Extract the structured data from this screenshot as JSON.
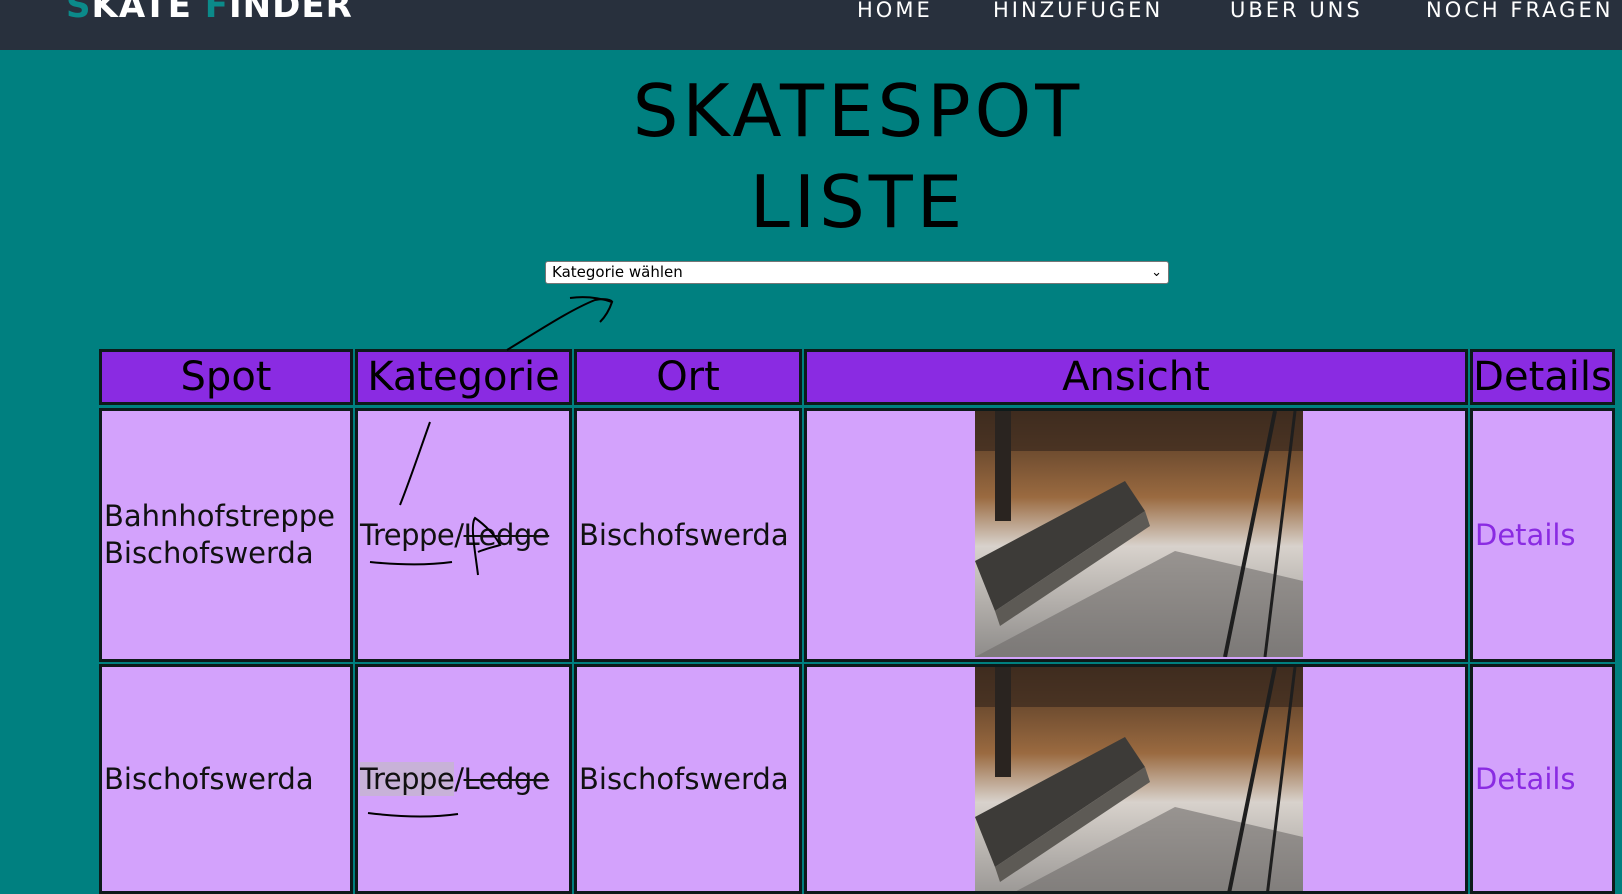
{
  "header": {
    "brand_first_letter": "S",
    "brand_rest_1": "KATE ",
    "brand_second_letter": "F",
    "brand_rest_2": "INDER",
    "nav": [
      "HOME",
      "HINZUFÜGEN",
      "ÜBER UNS",
      "NOCH FRAGEN"
    ]
  },
  "page": {
    "title_line1": "SKATESPOT",
    "title_line2": "LISTE"
  },
  "filter": {
    "selected": "Kategorie wählen"
  },
  "table": {
    "headers": [
      "Spot",
      "Kategorie",
      "Ort",
      "Ansicht",
      "Details"
    ],
    "rows": [
      {
        "spot_line1": "Bahnhofstreppe",
        "spot_line2": "Bischofswerda",
        "category_a": "Treppe",
        "separator": "/",
        "category_b": "Ledge",
        "location": "Bischofswerda",
        "details": "Details"
      },
      {
        "spot_line1": "Bischofswerda",
        "spot_line2": "",
        "category_a": "Treppe",
        "separator": "/",
        "category_b": "Ledge",
        "location": "Bischofswerda",
        "details": "Details"
      }
    ]
  },
  "colors": {
    "page_bg": "#008080",
    "navbar_bg": "#28303d",
    "brand_accent": "#0b8a8a",
    "header_cell": "#8a2be2",
    "body_cell": "#d3a2fc",
    "link": "#8a2be2"
  }
}
